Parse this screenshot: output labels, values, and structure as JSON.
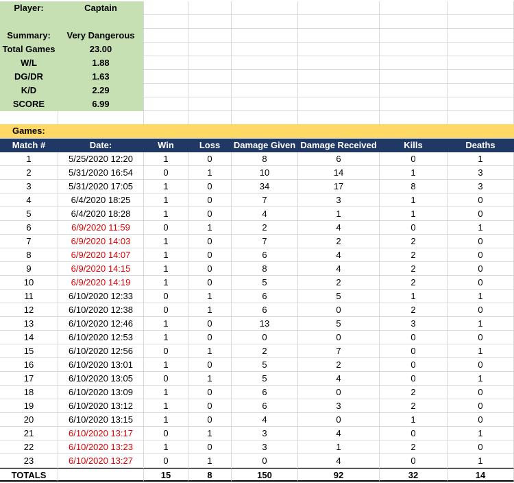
{
  "player": {
    "label": "Player:",
    "name": "Captain"
  },
  "summary": {
    "label": "Summary:",
    "value": "Very Dangerous",
    "stats": [
      {
        "label": "Total Games",
        "value": "23.00"
      },
      {
        "label": "W/L",
        "value": "1.88"
      },
      {
        "label": "DG/DR",
        "value": "1.63"
      },
      {
        "label": "K/D",
        "value": "2.29"
      },
      {
        "label": "SCORE",
        "value": "6.99"
      }
    ]
  },
  "games_label": "Games:",
  "columns": [
    "Match #",
    "Date:",
    "Win",
    "Loss",
    "Damage Given",
    "Damage Received",
    "Kills",
    "Deaths"
  ],
  "games": [
    [
      "1",
      "5/25/2020 12:20",
      "1",
      "0",
      "8",
      "6",
      "0",
      "1"
    ],
    [
      "2",
      "5/31/2020 16:54",
      "0",
      "1",
      "10",
      "14",
      "1",
      "3"
    ],
    [
      "3",
      "5/31/2020 17:05",
      "1",
      "0",
      "34",
      "17",
      "8",
      "3"
    ],
    [
      "4",
      "6/4/2020 18:25",
      "1",
      "0",
      "7",
      "3",
      "1",
      "0"
    ],
    [
      "5",
      "6/4/2020 18:28",
      "1",
      "0",
      "4",
      "1",
      "1",
      "0"
    ],
    [
      "6",
      "6/9/2020 11:59",
      "0",
      "1",
      "2",
      "4",
      "0",
      "1"
    ],
    [
      "7",
      "6/9/2020 14:03",
      "1",
      "0",
      "7",
      "2",
      "2",
      "0"
    ],
    [
      "8",
      "6/9/2020 14:07",
      "1",
      "0",
      "6",
      "4",
      "2",
      "0"
    ],
    [
      "9",
      "6/9/2020 14:15",
      "1",
      "0",
      "8",
      "4",
      "2",
      "0"
    ],
    [
      "10",
      "6/9/2020 14:19",
      "1",
      "0",
      "5",
      "2",
      "2",
      "0"
    ],
    [
      "11",
      "6/10/2020 12:33",
      "0",
      "1",
      "6",
      "5",
      "1",
      "1"
    ],
    [
      "12",
      "6/10/2020 12:38",
      "0",
      "1",
      "6",
      "0",
      "2",
      "0"
    ],
    [
      "13",
      "6/10/2020 12:46",
      "1",
      "0",
      "13",
      "5",
      "3",
      "1"
    ],
    [
      "14",
      "6/10/2020 12:53",
      "1",
      "0",
      "0",
      "0",
      "0",
      "0"
    ],
    [
      "15",
      "6/10/2020 12:56",
      "0",
      "1",
      "2",
      "7",
      "0",
      "1"
    ],
    [
      "16",
      "6/10/2020 13:01",
      "1",
      "0",
      "5",
      "2",
      "0",
      "0"
    ],
    [
      "17",
      "6/10/2020 13:05",
      "0",
      "1",
      "5",
      "4",
      "0",
      "1"
    ],
    [
      "18",
      "6/10/2020 13:09",
      "1",
      "0",
      "6",
      "0",
      "2",
      "0"
    ],
    [
      "19",
      "6/10/2020 13:12",
      "1",
      "0",
      "6",
      "3",
      "2",
      "0"
    ],
    [
      "20",
      "6/10/2020 13:15",
      "1",
      "0",
      "4",
      "0",
      "1",
      "0"
    ],
    [
      "21",
      "6/10/2020 13:17",
      "0",
      "1",
      "3",
      "4",
      "0",
      "1"
    ],
    [
      "22",
      "6/10/2020 13:23",
      "1",
      "0",
      "3",
      "1",
      "2",
      "0"
    ],
    [
      "23",
      "6/10/2020 13:27",
      "0",
      "1",
      "0",
      "4",
      "0",
      "1"
    ]
  ],
  "red_date_rows": [
    6,
    7,
    8,
    9,
    10,
    21,
    22,
    23
  ],
  "totals": [
    "TOTALS",
    "",
    "15",
    "8",
    "150",
    "92",
    "32",
    "14"
  ],
  "colors": {
    "summary_bg": "#c6e0b4",
    "games_bar": "#ffd966",
    "header_bg": "#1f3864",
    "highlight_text": "#e00000"
  }
}
